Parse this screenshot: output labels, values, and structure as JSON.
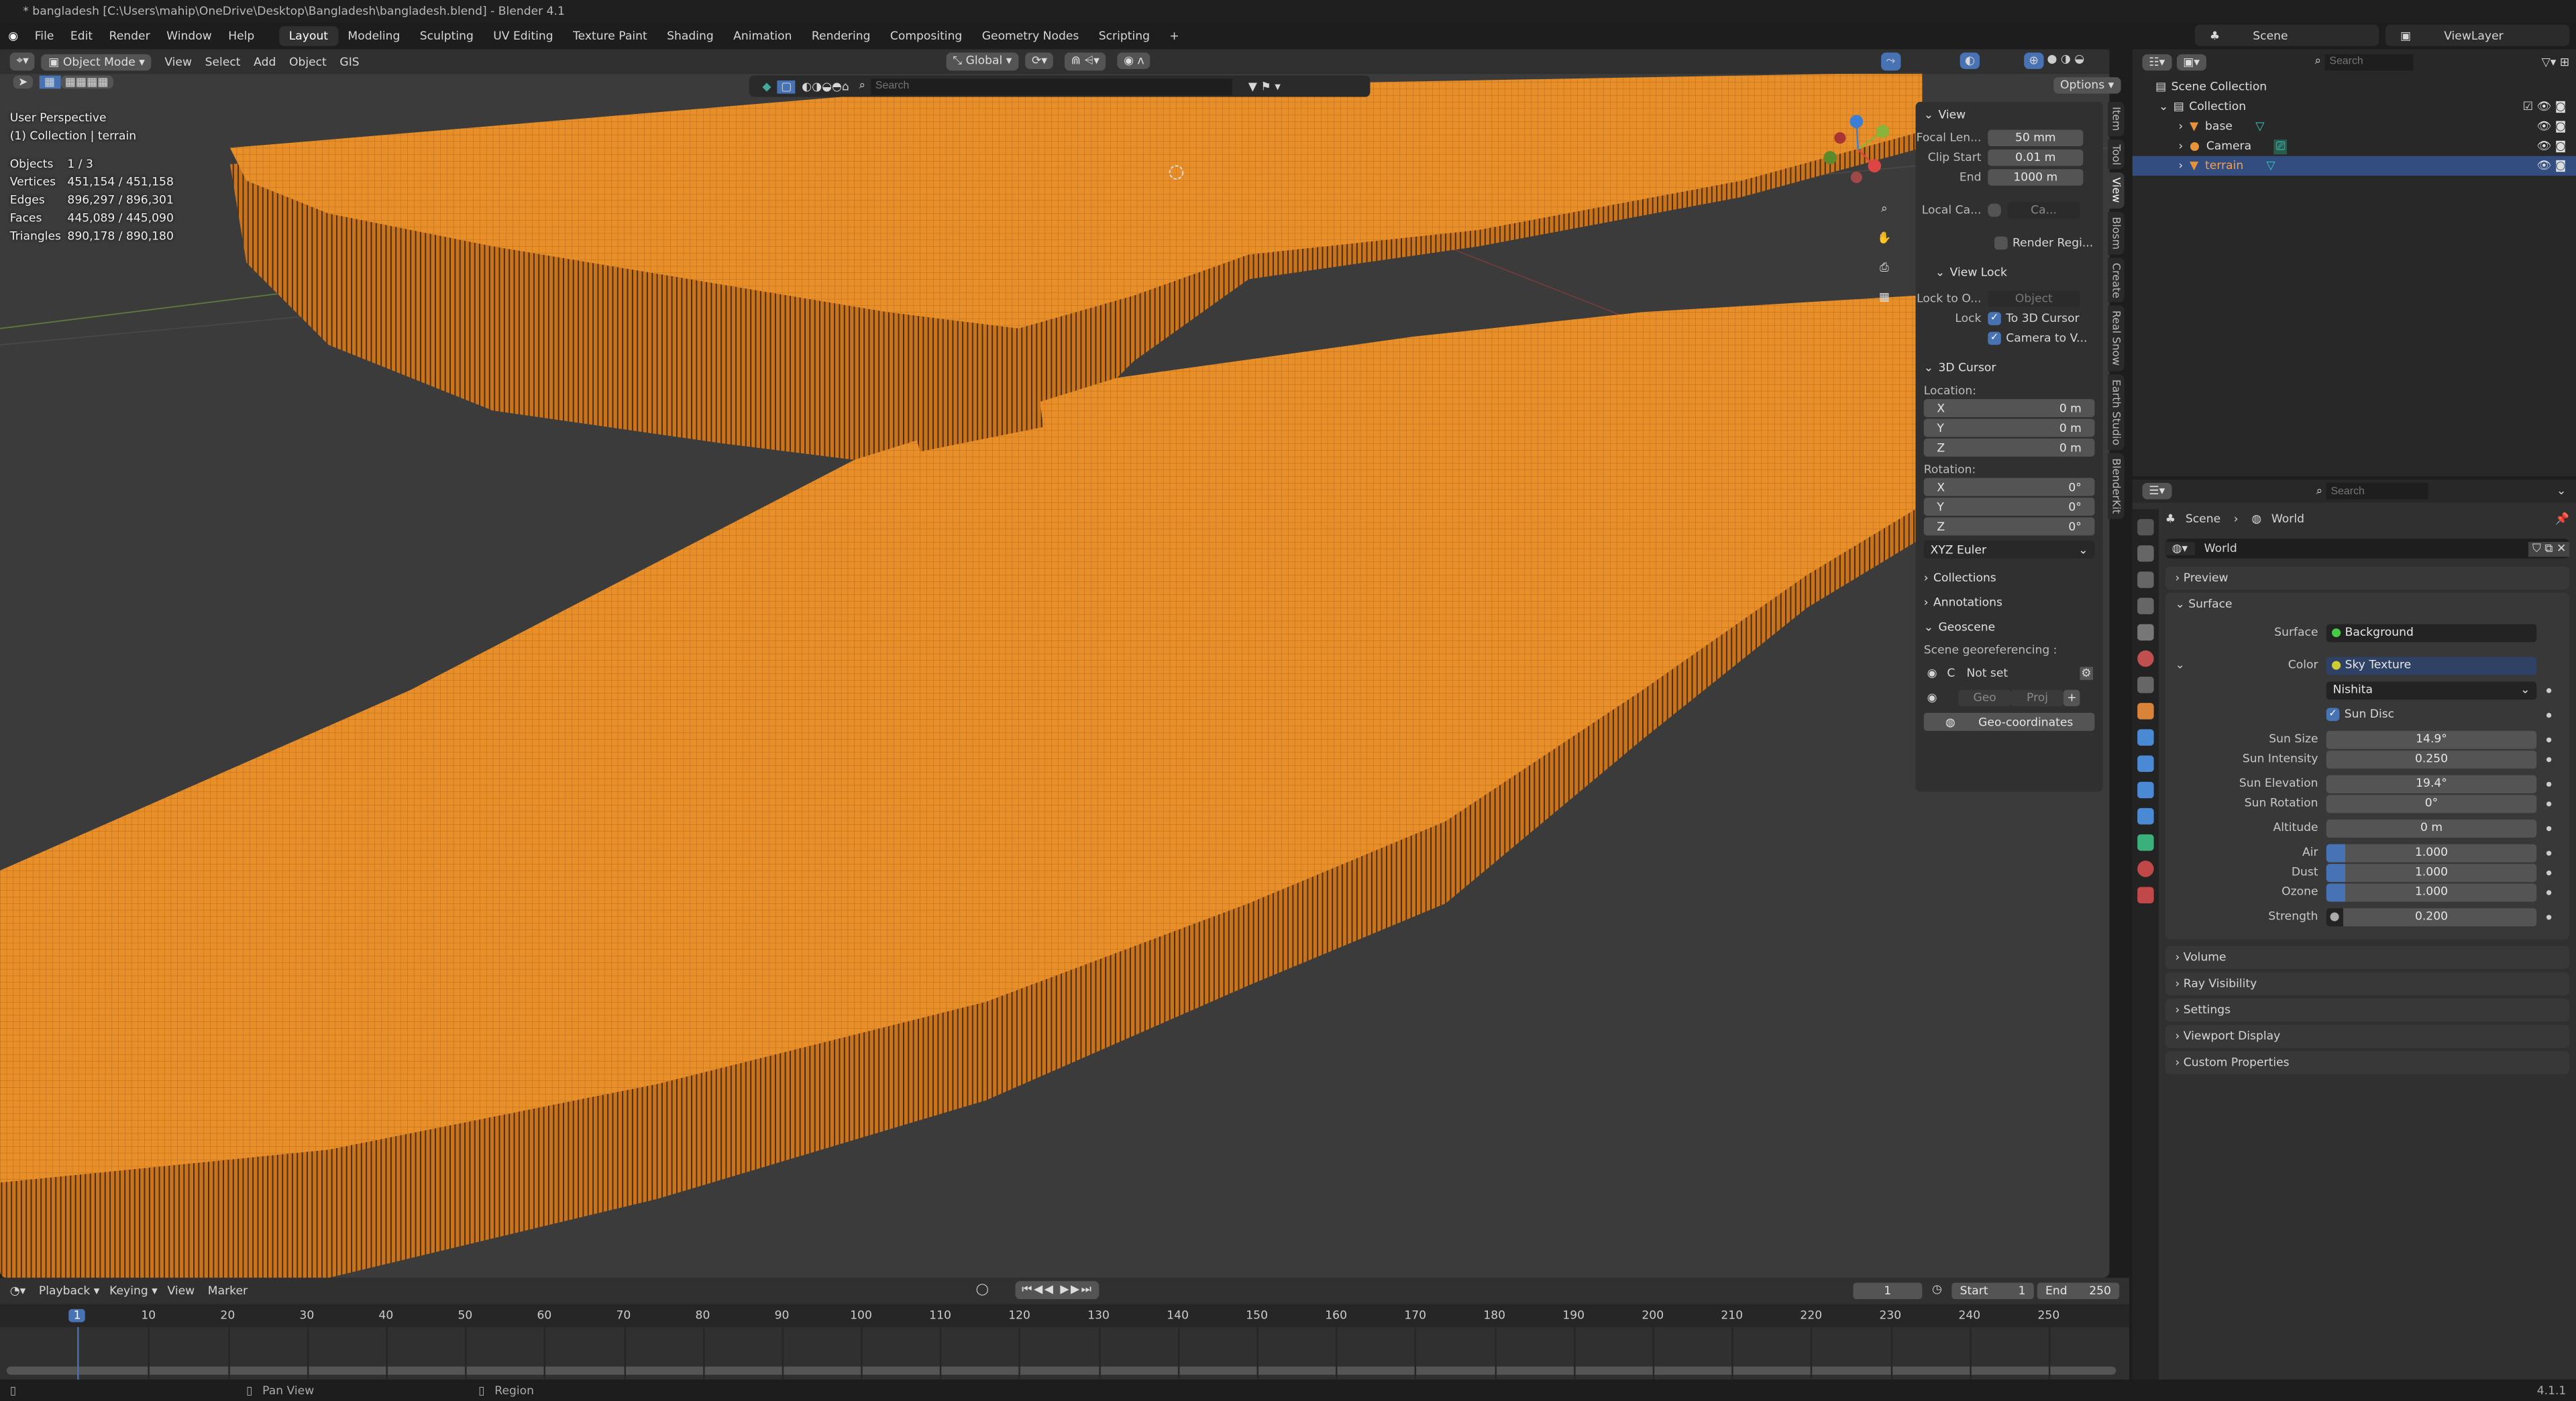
{
  "window": {
    "title": "* bangladesh [C:\\Users\\mahip\\OneDrive\\Desktop\\Bangladesh\\bangladesh.blend] - Blender 4.1"
  },
  "menu": [
    "File",
    "Edit",
    "Render",
    "Window",
    "Help"
  ],
  "workspaces": [
    "Layout",
    "Modeling",
    "Sculpting",
    "UV Editing",
    "Texture Paint",
    "Shading",
    "Animation",
    "Rendering",
    "Compositing",
    "Geometry Nodes",
    "Scripting",
    "+"
  ],
  "scene_selector": {
    "scene": "Scene",
    "view_layer": "ViewLayer"
  },
  "viewport": {
    "mode": "Object Mode",
    "menus": [
      "View",
      "Select",
      "Add",
      "Object",
      "GIS"
    ],
    "orientation": "Global",
    "search_placeholder": "Search",
    "options": "Options",
    "overlay": {
      "perspective": "User Perspective",
      "context": "(1) Collection | terrain",
      "stats": [
        {
          "label": "Objects",
          "value": "1 / 3"
        },
        {
          "label": "Vertices",
          "value": "451,154 / 451,158"
        },
        {
          "label": "Edges",
          "value": "896,297 / 896,301"
        },
        {
          "label": "Faces",
          "value": "445,089 / 445,090"
        },
        {
          "label": "Triangles",
          "value": "890,178 / 890,180"
        }
      ]
    },
    "colors": {
      "terrain": "#f0922a",
      "background": "#3b3b3b"
    }
  },
  "npanel": {
    "view_header": "View",
    "focal_label": "Focal Len...",
    "focal": "50 mm",
    "clip_start_label": "Clip Start",
    "clip_start": "0.01 m",
    "end_label": "End",
    "end": "1000 m",
    "local_cam_label": "Local Ca...",
    "local_cam": "Ca...",
    "render_region": "Render Regi...",
    "view_lock": "View Lock",
    "lock_to_label": "Lock to O...",
    "lock_to": "Object",
    "lock_label": "Lock",
    "to_3d_cursor": "To 3D Cursor",
    "camera_to_view": "Camera to V...",
    "cursor_header": "3D Cursor",
    "location_label": "Location:",
    "rotation_label": "Rotation:",
    "location": [
      {
        "axis": "X",
        "value": "0 m"
      },
      {
        "axis": "Y",
        "value": "0 m"
      },
      {
        "axis": "Z",
        "value": "0 m"
      }
    ],
    "rotation": [
      {
        "axis": "X",
        "value": "0°"
      },
      {
        "axis": "Y",
        "value": "0°"
      },
      {
        "axis": "Z",
        "value": "0°"
      }
    ],
    "rotation_mode": "XYZ Euler",
    "collections": "Collections",
    "annotations": "Annotations",
    "geoscene": "Geoscene",
    "georef_label": "Scene georeferencing :",
    "crs_c": "C",
    "crs": "Not set",
    "geo": "Geo",
    "proj": "Proj",
    "geo_coords": "Geo-coordinates",
    "tabs": [
      "Item",
      "Tool",
      "View",
      "Blosm",
      "Create",
      "Real Snow",
      "Earth Studio",
      "BlenderKit"
    ]
  },
  "outliner": {
    "search_placeholder": "Search",
    "scene_collection": "Scene Collection",
    "collection": "Collection",
    "items": [
      {
        "name": "base"
      },
      {
        "name": "Camera"
      },
      {
        "name": "terrain",
        "selected": true
      }
    ]
  },
  "properties": {
    "search_placeholder": "Search",
    "breadcrumb": [
      "Scene",
      "World"
    ],
    "world_name": "World",
    "preview": "Preview",
    "surface_panel": "Surface",
    "surface_label": "Surface",
    "surface": "Background",
    "color_label": "Color",
    "color": "Sky Texture",
    "sky_type": "Nishita",
    "sun_disc": "Sun Disc",
    "fields": [
      {
        "label": "Sun Size",
        "value": "14.9°"
      },
      {
        "label": "Sun Intensity",
        "value": "0.250"
      },
      {
        "label": "Sun Elevation",
        "value": "19.4°"
      },
      {
        "label": "Sun Rotation",
        "value": "0°"
      },
      {
        "label": "Altitude",
        "value": "0 m"
      },
      {
        "label": "Air",
        "value": "1.000"
      },
      {
        "label": "Dust",
        "value": "1.000"
      },
      {
        "label": "Ozone",
        "value": "1.000"
      },
      {
        "label": "Strength",
        "value": "0.200"
      }
    ],
    "collapsed": [
      "Volume",
      "Ray Visibility",
      "Settings",
      "Viewport Display",
      "Custom Properties"
    ]
  },
  "timeline": {
    "menus": [
      "Playback",
      "Keying",
      "View",
      "Marker"
    ],
    "current_frame": "1",
    "start_label": "Start",
    "start": "1",
    "end_label": "End",
    "end": "250",
    "ticks": [
      "1",
      "10",
      "20",
      "30",
      "40",
      "50",
      "60",
      "70",
      "80",
      "90",
      "100",
      "110",
      "120",
      "130",
      "140",
      "150",
      "160",
      "170",
      "180",
      "190",
      "200",
      "210",
      "220",
      "230",
      "240",
      "250"
    ]
  },
  "status": {
    "pan": "Pan View",
    "region": "Region",
    "version": "4.1.1"
  }
}
